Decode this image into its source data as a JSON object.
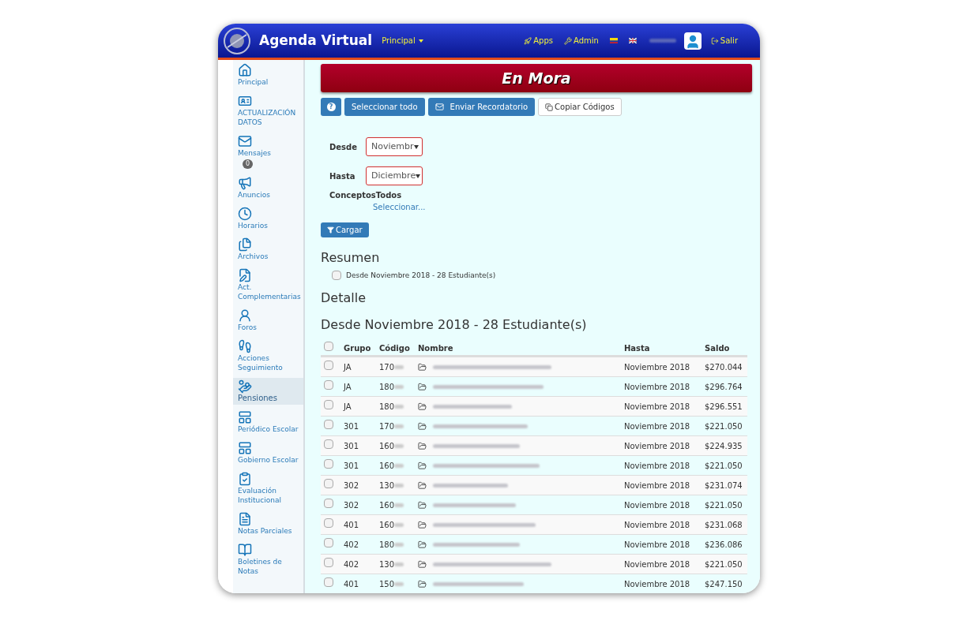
{
  "header": {
    "title": "Agenda Virtual",
    "menu": "Principal",
    "links": [
      "Apps",
      "Admin"
    ],
    "logout": "Salir"
  },
  "sidebar": {
    "items": [
      {
        "label": "Principal",
        "selected": false
      },
      {
        "label": "ACTUALIZACIÓN DATOS",
        "selected": false
      },
      {
        "label": "Mensajes",
        "selected": false,
        "badge": "0"
      },
      {
        "label": "Anuncios",
        "selected": false
      },
      {
        "label": "Horarios",
        "selected": false
      },
      {
        "label": "Archivos",
        "selected": false
      },
      {
        "label": "Act. Complementarias",
        "selected": false
      },
      {
        "label": "Foros",
        "selected": false
      },
      {
        "label": "Acciones Seguimiento",
        "selected": false
      },
      {
        "label": "Pensiones",
        "selected": true
      },
      {
        "label": "Periódico Escolar",
        "selected": false
      },
      {
        "label": "Gobierno Escolar",
        "selected": false
      },
      {
        "label": "Evaluación Institucional",
        "selected": false
      },
      {
        "label": "Notas Parciales",
        "selected": false
      },
      {
        "label": "Boletines de Notas",
        "selected": false
      }
    ]
  },
  "banner": "En Mora",
  "toolbar": {
    "help": "?",
    "select_all": "Seleccionar todo",
    "send": "Enviar Recordatorio",
    "copy": "Copiar Códigos"
  },
  "filters": {
    "from_label": "Desde",
    "from_value": "Noviembr",
    "to_label": "Hasta",
    "to_value": "Diciembre",
    "concepts_label": "Conceptos",
    "concepts_value": "Todos",
    "concepts_link": "Seleccionar...",
    "load": "Cargar"
  },
  "summary": {
    "title": "Resumen",
    "item": "Desde Noviembre 2018 - 28 Estudiante(s)",
    "checked": false
  },
  "detail_title": "Detalle",
  "table": {
    "title": "Desde Noviembre 2018 - 28 Estudiante(s)",
    "all_checked": false,
    "columns": [
      "Grupo",
      "Código",
      "Nombre",
      "Hasta",
      "Saldo"
    ],
    "rows": [
      {
        "checked": false,
        "grupo": "JA",
        "codigo": "170",
        "hasta": "Noviembre 2018",
        "saldo": "$270.044"
      },
      {
        "checked": false,
        "grupo": "JA",
        "codigo": "180",
        "hasta": "Noviembre 2018",
        "saldo": "$296.764"
      },
      {
        "checked": false,
        "grupo": "JA",
        "codigo": "180",
        "hasta": "Noviembre 2018",
        "saldo": "$296.551"
      },
      {
        "checked": false,
        "grupo": "301",
        "codigo": "170",
        "hasta": "Noviembre 2018",
        "saldo": "$221.050"
      },
      {
        "checked": false,
        "grupo": "301",
        "codigo": "160",
        "hasta": "Noviembre 2018",
        "saldo": "$224.935"
      },
      {
        "checked": false,
        "grupo": "301",
        "codigo": "160",
        "hasta": "Noviembre 2018",
        "saldo": "$221.050"
      },
      {
        "checked": false,
        "grupo": "302",
        "codigo": "130",
        "hasta": "Noviembre 2018",
        "saldo": "$231.074"
      },
      {
        "checked": false,
        "grupo": "302",
        "codigo": "160",
        "hasta": "Noviembre 2018",
        "saldo": "$221.050"
      },
      {
        "checked": false,
        "grupo": "401",
        "codigo": "160",
        "hasta": "Noviembre 2018",
        "saldo": "$231.068"
      },
      {
        "checked": false,
        "grupo": "402",
        "codigo": "180",
        "hasta": "Noviembre 2018",
        "saldo": "$236.086"
      },
      {
        "checked": false,
        "grupo": "402",
        "codigo": "130",
        "hasta": "Noviembre 2018",
        "saldo": "$221.050"
      },
      {
        "checked": false,
        "grupo": "401",
        "codigo": "150",
        "hasta": "Noviembre 2018",
        "saldo": "$247.150"
      }
    ]
  }
}
